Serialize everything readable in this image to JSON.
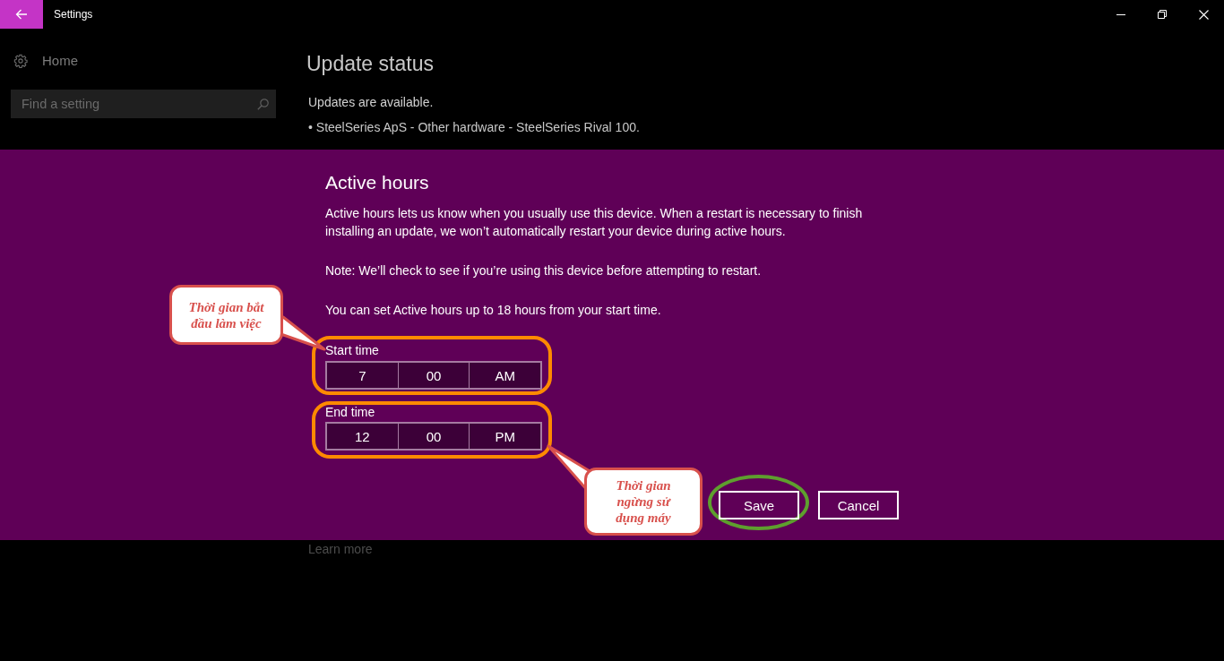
{
  "window": {
    "title": "Settings"
  },
  "sidebar": {
    "home": "Home",
    "search": {
      "placeholder": "Find a setting"
    }
  },
  "update_status": {
    "title": "Update status",
    "message": "Updates are available.",
    "updates": [
      "• SteelSeries ApS - Other hardware - SteelSeries Rival 100."
    ],
    "link": "Learn more"
  },
  "active_hours_dialog": {
    "title": "Active hours",
    "paragraphs": [
      "Active hours lets us know when you usually use this device. When a restart is necessary to finish installing an update, we won’t automatically restart your device during active hours.",
      "Note: We’ll check to see if you’re using this device before attempting to restart.",
      "You can set Active hours up to 18 hours from your start time."
    ],
    "time_fields": [
      {
        "label": "Start time",
        "hour": "7",
        "minute": "00",
        "period": "AM",
        "highlighted": true
      },
      {
        "label": "End time",
        "hour": "12",
        "minute": "00",
        "period": "PM",
        "highlighted": true
      }
    ],
    "buttons": [
      {
        "label": "Save",
        "circled": true
      },
      {
        "label": "Cancel",
        "circled": false
      }
    ]
  },
  "annotations": [
    {
      "kind": "callout",
      "text": "Thời gian bắt đầu làm việc"
    },
    {
      "kind": "callout",
      "text": "Thời gian ngừng sử dụng máy"
    }
  ]
}
